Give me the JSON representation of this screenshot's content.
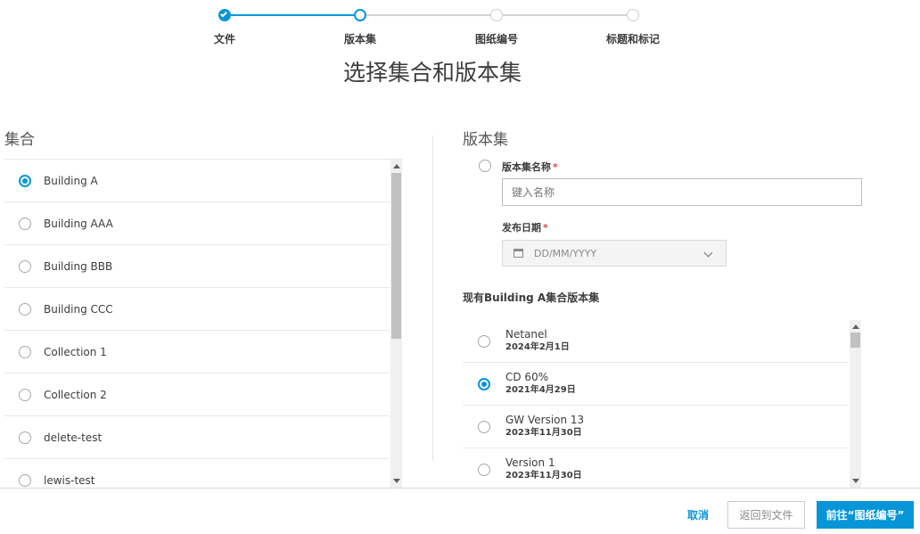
{
  "stepper": {
    "steps": [
      {
        "label": "文件",
        "state": "done"
      },
      {
        "label": "版本集",
        "state": "active"
      },
      {
        "label": "图纸编号",
        "state": "pending"
      },
      {
        "label": "标题和标记",
        "state": "pending"
      }
    ]
  },
  "page_title": "选择集合和版本集",
  "collections": {
    "title": "集合",
    "items": [
      {
        "label": "Building A",
        "selected": true
      },
      {
        "label": "Building AAA",
        "selected": false
      },
      {
        "label": "Building BBB",
        "selected": false
      },
      {
        "label": "Building CCC",
        "selected": false
      },
      {
        "label": "Collection 1",
        "selected": false
      },
      {
        "label": "Collection 2",
        "selected": false
      },
      {
        "label": "delete-test",
        "selected": false
      },
      {
        "label": "lewis-test",
        "selected": false
      }
    ]
  },
  "version_sets": {
    "title": "版本集",
    "name_label": "版本集名称",
    "name_placeholder": "键入名称",
    "date_label": "发布日期",
    "date_placeholder": "DD/MM/YYYY",
    "required_mark": "*",
    "existing_label": "现有Building A集合版本集",
    "existing": [
      {
        "name": "Netanel",
        "date": "2024年2月1日",
        "selected": false
      },
      {
        "name": "CD 60%",
        "date": "2021年4月29日",
        "selected": true
      },
      {
        "name": "GW Version 13",
        "date": "2023年11月30日",
        "selected": false
      },
      {
        "name": "Version 1",
        "date": "2023年11月30日",
        "selected": false
      }
    ]
  },
  "footer": {
    "cancel": "取消",
    "back": "返回到文件",
    "next": "前往“图纸编号”"
  },
  "colors": {
    "accent": "#0696d7",
    "required": "#e0433b"
  }
}
